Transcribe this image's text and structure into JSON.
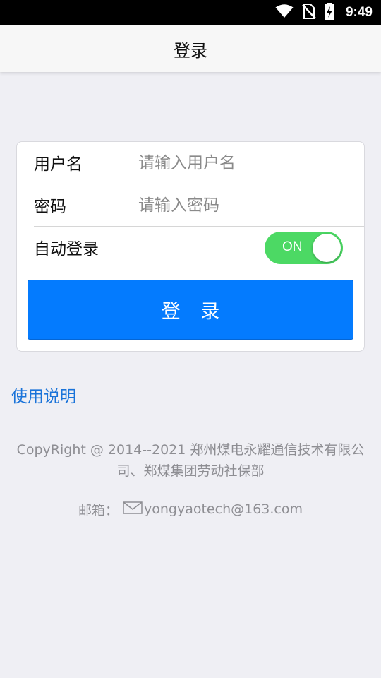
{
  "status_bar": {
    "time": "9:49",
    "icons": [
      "wifi-icon",
      "no-sim-icon",
      "battery-charging-icon"
    ]
  },
  "header": {
    "title": "登录"
  },
  "login_form": {
    "username": {
      "label": "用户名",
      "placeholder": "请输入用户名",
      "value": ""
    },
    "password": {
      "label": "密码",
      "placeholder": "请输入密码",
      "value": ""
    },
    "auto_login": {
      "label": "自动登录",
      "state": "ON",
      "on": true
    },
    "submit_label": "登 录"
  },
  "help_link": "使用说明",
  "footer": {
    "copyright": "CopyRight @ 2014--2021 郑州煤电永耀通信技术有限公司、郑煤集团劳动社保部",
    "email_label": "邮箱：",
    "email_icon": "mail-icon",
    "email": "yongyaotech@163.com"
  },
  "colors": {
    "background": "#efeff4",
    "primary_button": "#047bfe",
    "toggle_on": "#4cd964",
    "link": "#1a73d9",
    "footer_text": "#8e8e93"
  }
}
